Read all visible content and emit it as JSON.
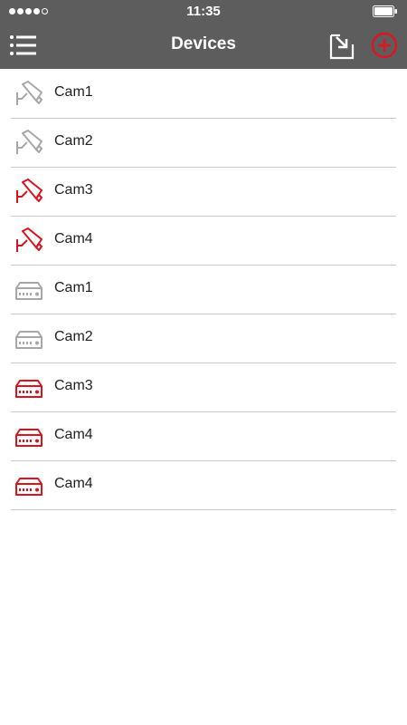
{
  "status_bar": {
    "time": "11:35",
    "signal_bars_filled": 4,
    "signal_bars_total": 5,
    "battery_level": 1.0
  },
  "header": {
    "title": "Devices",
    "left_icon": "menu-list-icon",
    "right_icons": [
      "import-icon",
      "add-circle-icon"
    ]
  },
  "colors": {
    "header_bg": "#5d5d5d",
    "accent_red": "#d9141d",
    "inactive_gray": "#a7a7a7",
    "divider": "#c8c8c8"
  },
  "devices": [
    {
      "name": "Cam1",
      "type": "camera",
      "status": "gray"
    },
    {
      "name": "Cam2",
      "type": "camera",
      "status": "gray"
    },
    {
      "name": "Cam3",
      "type": "camera",
      "status": "red"
    },
    {
      "name": "Cam4",
      "type": "camera",
      "status": "red"
    },
    {
      "name": "Cam1",
      "type": "recorder",
      "status": "gray"
    },
    {
      "name": "Cam2",
      "type": "recorder",
      "status": "gray"
    },
    {
      "name": "Cam3",
      "type": "recorder",
      "status": "red"
    },
    {
      "name": "Cam4",
      "type": "recorder",
      "status": "red"
    },
    {
      "name": "Cam4",
      "type": "recorder",
      "status": "red"
    }
  ]
}
